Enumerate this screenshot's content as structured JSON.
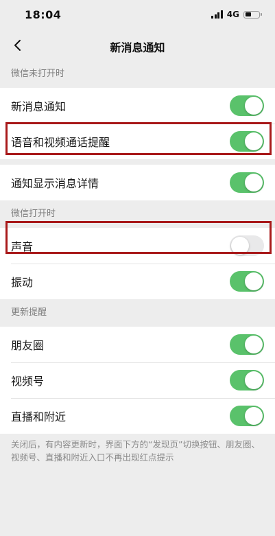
{
  "status_bar": {
    "time": "18:04",
    "network": "4G"
  },
  "nav": {
    "title": "新消息通知",
    "back_icon": "chevron-left-icon"
  },
  "sections": [
    {
      "header": "微信未打开时",
      "rows": [
        {
          "label": "新消息通知",
          "on": true
        },
        {
          "label": "语音和视频通话提醒",
          "on": true,
          "highlighted": true
        }
      ]
    },
    {
      "header": "",
      "rows": [
        {
          "label": "通知显示消息详情",
          "on": true
        }
      ]
    },
    {
      "header": "微信打开时",
      "rows": [
        {
          "label": "声音",
          "on": false,
          "highlighted": true
        },
        {
          "label": "振动",
          "on": true
        }
      ]
    },
    {
      "header": "更新提醒",
      "rows": [
        {
          "label": "朋友圈",
          "on": true
        },
        {
          "label": "视频号",
          "on": true
        },
        {
          "label": "直播和附近",
          "on": true
        }
      ]
    }
  ],
  "footnote": "关闭后，有内容更新时，界面下方的“发现页”切换按钮、朋友圈、视频号、直播和附近入口不再出现红点提示",
  "colors": {
    "toggle_on": "#5ac26b",
    "toggle_off": "#e9e9ea",
    "highlight_border": "#a8191a",
    "background": "#ededed"
  }
}
